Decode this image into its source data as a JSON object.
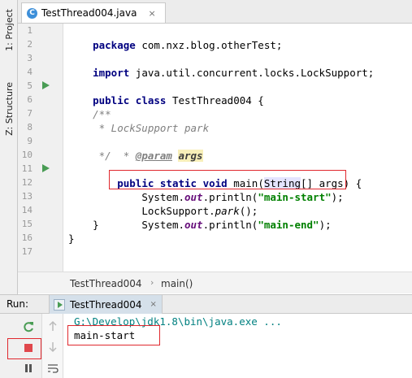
{
  "tool_windows": {
    "project": "1: Project",
    "structure": "Z: Structure"
  },
  "editor_tab": {
    "title": "TestThread004.java",
    "badge": "C",
    "close": "×"
  },
  "line_numbers": [
    "1",
    "2",
    "3",
    "4",
    "5",
    "6",
    "7",
    "8",
    "9",
    "10",
    "11",
    "12",
    "13",
    "14",
    "15",
    "16",
    "17"
  ],
  "code": {
    "l1_kw": "package",
    "l1_rest": " com.nxz.blog.otherTest;",
    "l3_kw": "import",
    "l3_rest": " java.util.concurrent.locks.LockSupport;",
    "l5_kw": "public class",
    "l5_rest": " TestThread004 {",
    "l7": "    /**",
    "l8": "     * LockSupport park",
    "l9_pre": "     * ",
    "l9_tag": "@param",
    "l9_sp": " ",
    "l9_arg": "args",
    "l10": "     */",
    "l11_kw": "    public static void",
    "l11_mid": " main(",
    "l11_type": "String",
    "l11_end": "[] args) {",
    "l12_pre": "        System.",
    "l12_field": "out",
    "l12_mid": ".println(",
    "l12_str": "\"main-start\"",
    "l12_end": ");",
    "l13_pre": "        LockSupport.",
    "l13_method": "park",
    "l13_end": "();",
    "l14_pre": "        System.",
    "l14_field": "out",
    "l14_mid": ".println(",
    "l14_str": "\"main-end\"",
    "l14_end": ");",
    "l15": "    }",
    "l16": "}"
  },
  "breadcrumb": {
    "class_name": "TestThread004",
    "separator": "›",
    "method": "main()"
  },
  "run_panel": {
    "label": "Run:",
    "tab_title": "TestThread004",
    "tab_close": "×",
    "console": {
      "command": "G:\\Develop\\jdk1.8\\bin\\java.exe ...",
      "output": "main-start"
    }
  },
  "colors": {
    "keyword": "#000080",
    "string": "#008000",
    "field": "#660e7a",
    "comment": "#808080",
    "highlight_box": "#e0282e",
    "run_green": "#499c54",
    "stop_red": "#e0474c"
  },
  "icons": {
    "run_gutter": "run-gutter-icon",
    "intention": "lightbulb-icon",
    "rerun": "rerun-icon",
    "stop": "stop-icon",
    "pause": "pause-icon",
    "scroll_up": "arrow-up-icon",
    "scroll_down": "arrow-down-icon",
    "soft_wrap": "soft-wrap-icon"
  }
}
